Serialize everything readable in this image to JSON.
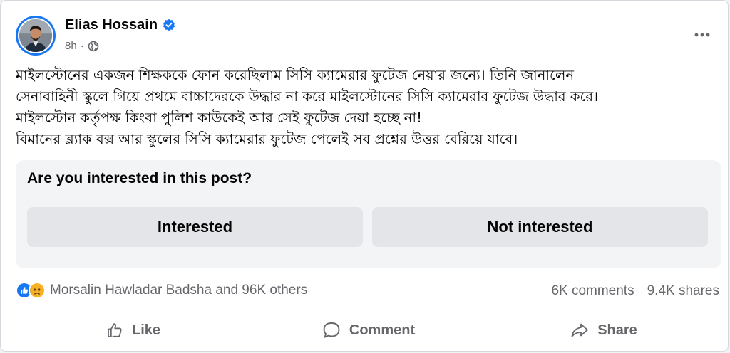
{
  "post": {
    "author": "Elias Hossain",
    "time": "8h",
    "separator": "·",
    "more_icon": "more-horizontal-icon",
    "privacy_icon": "globe-icon",
    "lines": [
      "মাইলস্টোনের একজন শিক্ষককে ফোন করেছিলাম সিসি ক্যামেরার ফুটেজ নেয়ার জন্যে। তিনি জানালেন",
      "সেনাবাহিনী স্কুলে গিয়ে প্রথমে বাচ্চাদেরকে উদ্ধার না করে মাইলস্টোনের সিসি ক্যামেরার ফুটেজ উদ্ধার করে।",
      "মাইলস্টোন কর্তৃপক্ষ কিংবা পুলিশ কাউকেই আর সেই ফুটেজ দেয়া হচ্ছে না!",
      "বিমানের ব্ল্যাক বক্স আর স্কুলের সিসি ক্যামেরার ফুটেজ পেলেই সব প্রশ্নের উত্তর বেরিয়ে যাবে।"
    ]
  },
  "survey": {
    "question": "Are you interested in this post?",
    "interested_label": "Interested",
    "not_interested_label": "Not interested"
  },
  "engagement": {
    "reactions_text": "Morsalin Hawladar Badsha and 96K others",
    "comments": "6K comments",
    "shares": "9.4K shares"
  },
  "actions": {
    "like": "Like",
    "comment": "Comment",
    "share": "Share"
  },
  "colors": {
    "accent": "#1877f2",
    "secondary_text": "#65676b",
    "survey_bg": "#f3f4f6",
    "button_bg": "#e3e5e9"
  }
}
